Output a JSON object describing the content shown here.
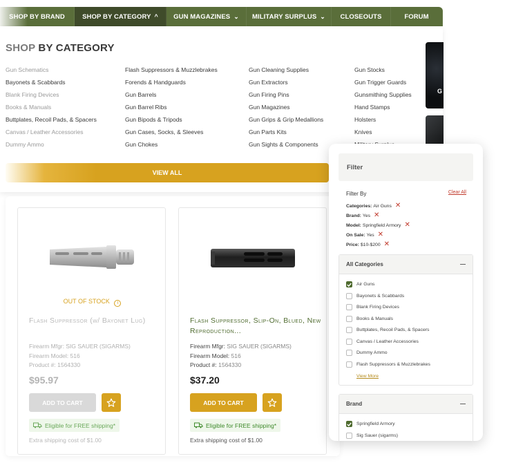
{
  "nav": {
    "items": [
      {
        "label": "SHOP BY BRAND",
        "chevron": ""
      },
      {
        "label": "SHOP BY CATEGORY",
        "chevron": "^"
      },
      {
        "label": "GUN MAGAZINES",
        "chevron": "⌄"
      },
      {
        "label": "MILITARY SURPLUS",
        "chevron": "⌄"
      },
      {
        "label": "CLOSEOUTS",
        "chevron": ""
      },
      {
        "label": "FORUM",
        "chevron": ""
      }
    ]
  },
  "category": {
    "title_a": "SHOP",
    "title_b": " BY CATEGORY",
    "col1": [
      "Gun Schematics",
      "Bayonets & Scabbards",
      "Blank Firing Devices",
      "Books & Manuals",
      "Buttplates, Recoil Pads, & Spacers",
      "Canvas / Leather Accessories",
      "Dummy Ammo"
    ],
    "col2": [
      "Flash Suppressors & Muzzlebrakes",
      "Forends & Handguards",
      "Gun Barrels",
      "Gun Barrel Ribs",
      "Gun Bipods & Tripods",
      "Gun Cases, Socks, & Sleeves",
      "Gun Chokes"
    ],
    "col3": [
      "Gun Cleaning Supplies",
      "Gun Extractors",
      "Gun Firing Pins",
      "Gun Magazines",
      "Gun Grips & Grip Medallions",
      "Gun Parts Kits",
      "Gun Sights & Components"
    ],
    "col4": [
      "Gun Stocks",
      "Gun Trigger Guards",
      "Gunsmithing Supplies",
      "Hand Stamps",
      "Holsters",
      "Knives",
      "Military Surplus"
    ],
    "view_all": "VIEW ALL",
    "promo_letter": "G"
  },
  "products": [
    {
      "status": "OUT OF STOCK",
      "name": "Flash Suppressor (w/ Bayonet Lug)",
      "mfgr_label": "Firearm Mfgr: ",
      "mfgr": "SIG SAUER (SIGARMS)",
      "model_label": "Firearm Model: ",
      "model": "516",
      "product_label": "Product #: ",
      "product_no": "1564330",
      "price": "$95.97",
      "cart": "ADD TO CART",
      "shipping": "Eligible for FREE shipping*",
      "extra": "Extra shipping cost of $1.00"
    },
    {
      "status": "",
      "name": "Flash Suppressor, Slip-On, Blued, New Reproduction...",
      "mfgr_label": "Firearm Mfgr: ",
      "mfgr": "SIG SAUER (SIGARMS)",
      "model_label": "Firearm Model: ",
      "model": "516",
      "product_label": "Product #: ",
      "product_no": "1564330",
      "price": "$37.20",
      "cart": "ADD TO CART",
      "shipping": "Eligible for FREE shipping*",
      "extra": "Extra shipping cost of $1.00"
    }
  ],
  "filter": {
    "title": "Filter",
    "filter_by": "Filter By",
    "clear_all": "Clear All",
    "chips": [
      {
        "key": "Categories:",
        "val": "Air Guns"
      },
      {
        "key": "Brand:",
        "val": "Yes"
      },
      {
        "key": "Model:",
        "val": "Springfield Armory"
      },
      {
        "key": "On Sale:",
        "val": "Yes"
      },
      {
        "key": "Price:",
        "val": "$10-$200"
      }
    ],
    "categories_title": "All Categories",
    "categories": [
      {
        "label": "Air Guns",
        "checked": true
      },
      {
        "label": "Bayonets & Scabbards",
        "checked": false
      },
      {
        "label": "Blank Firing Devices",
        "checked": false
      },
      {
        "label": "Books & Manuals",
        "checked": false
      },
      {
        "label": "Buttplates, Recoil Pads, & Spacers",
        "checked": false
      },
      {
        "label": "Canvas / Leather Accessories",
        "checked": false
      },
      {
        "label": "Dummy Ammo",
        "checked": false
      },
      {
        "label": "Flash Suppressors & Muzzlebrakes",
        "checked": false
      }
    ],
    "view_more": "View More",
    "brand_title": "Brand",
    "brands": [
      {
        "label": "Springfield Armory",
        "checked": true
      },
      {
        "label": "Sig Sauer (sigarms)",
        "checked": false
      }
    ],
    "collapse": "—"
  },
  "colors": {
    "nav": "#5a6e3a",
    "accent": "#d7a21f",
    "ship_green": "#3e8a2b",
    "danger": "#c0392b"
  }
}
